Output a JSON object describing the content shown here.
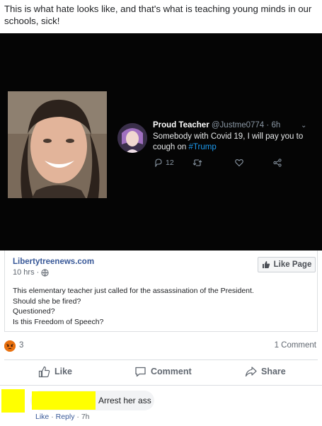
{
  "caption": "This is what hate looks like, and that's what is teaching young minds in our schools, sick!",
  "tweet": {
    "name": "Proud Teacher",
    "handle": "@Justme0774",
    "time": "6h",
    "text": "Somebody with Covid 19, I will pay you to cough on",
    "hashtag": "#Trump",
    "replies": "12"
  },
  "card": {
    "page_name": "Libertytreenews.com",
    "time": "10 hrs",
    "like_page_label": "Like Page",
    "body_lines": [
      "This elementary teacher just called for the assassination of the President.",
      "Should she be fired?",
      "Questioned?",
      "Is this Freedom of Speech?"
    ]
  },
  "stats": {
    "reactions": "3",
    "comments": "1 Comment"
  },
  "actions": {
    "like": "Like",
    "comment": "Comment",
    "share": "Share"
  },
  "comment": {
    "text": "Arrest her ass",
    "like": "Like",
    "reply": "Reply",
    "time": "7h"
  },
  "colors": {
    "link": "#385898",
    "tweet_bg": "#050505",
    "hashtag": "#1d9bf0",
    "angry": "#e9710f",
    "redaction": "#ffff00"
  },
  "icons": [
    "globe-icon",
    "thumbs-up-icon",
    "comment-icon",
    "share-icon",
    "reply-icon",
    "retweet-icon",
    "heart-icon",
    "angry-reaction-icon"
  ]
}
